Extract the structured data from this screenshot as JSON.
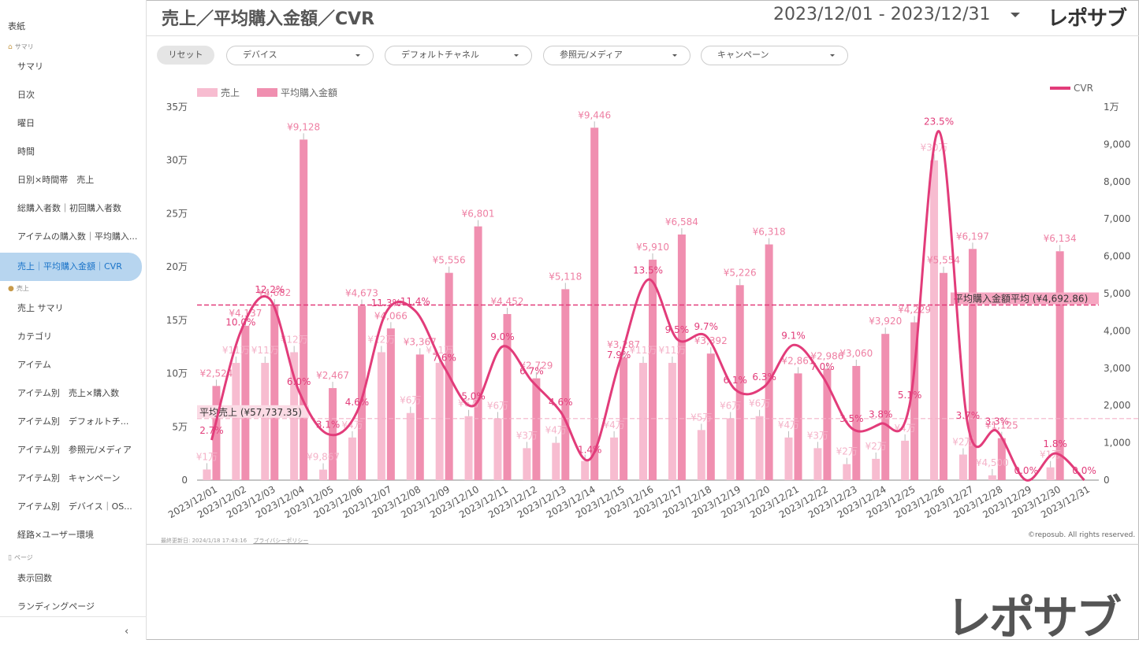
{
  "sidebar": {
    "top_label": "表紙",
    "sections": [
      {
        "label": "サマリ",
        "items": [
          "サマリ",
          "日次",
          "曜日",
          "時間",
          "日別×時間帯　売上",
          "総購入者数｜初回購入者数",
          "アイテムの購入数｜平均購入...",
          "売上｜平均購入金額｜CVR"
        ]
      },
      {
        "label": "売上",
        "items": [
          "売上 サマリ",
          "カテゴリ",
          "アイテム",
          "アイテム別　売上×購入数",
          "アイテム別　デフォルトチ...",
          "アイテム別　参照元/メディア",
          "アイテム別　キャンペーン",
          "アイテム別　デバイス｜OS...",
          "経路×ユーザー環境"
        ]
      },
      {
        "label": "ページ",
        "items": [
          "表示回数",
          "ランディングページ"
        ]
      }
    ],
    "active_item": "売上｜平均購入金額｜CVR",
    "collapse_icon": "chevron-left-icon"
  },
  "header": {
    "title": "売上／平均購入金額／CVR",
    "date_range": "2023/12/01 - 2023/12/31",
    "logo": "レポサブ"
  },
  "filters": {
    "reset_label": "リセット",
    "items": [
      "デバイス",
      "デフォルトチャネル",
      "参照元/メディア",
      "キャンペーン"
    ]
  },
  "footer": {
    "updated": "最終更新日: 2024/1/18 17:43:16",
    "privacy": "プライバシーポリシー",
    "copyright": "©reposub. All rights reserved."
  },
  "logo_bottom": "レポサブ",
  "colors": {
    "sales": "#f7bcd0",
    "avg": "#f08fb0",
    "cvr": "#e23c7a"
  },
  "chart_data": {
    "type": "bar",
    "legend": {
      "left": [
        "売上",
        "平均購入金額"
      ],
      "right": "CVR"
    },
    "left_ticks": [
      "0",
      "5万",
      "10万",
      "15万",
      "20万",
      "25万",
      "30万",
      "35万"
    ],
    "right_ticks": [
      "0",
      "1,000",
      "2,000",
      "3,000",
      "4,000",
      "5,000",
      "6,000",
      "7,000",
      "8,000",
      "9,000",
      "1万"
    ],
    "ylim_left": [
      0,
      350000
    ],
    "ylim_right": [
      0,
      10000
    ],
    "categories": [
      "2023/12/01",
      "2023/12/02",
      "2023/12/03",
      "2023/12/04",
      "2023/12/05",
      "2023/12/06",
      "2023/12/07",
      "2023/12/08",
      "2023/12/09",
      "2023/12/10",
      "2023/12/11",
      "2023/12/12",
      "2023/12/13",
      "2023/12/14",
      "2023/12/15",
      "2023/12/16",
      "2023/12/17",
      "2023/12/18",
      "2023/12/19",
      "2023/12/20",
      "2023/12/21",
      "2023/12/22",
      "2023/12/23",
      "2023/12/24",
      "2023/12/25",
      "2023/12/26",
      "2023/12/27",
      "2023/12/28",
      "2023/12/29",
      "2023/12/30",
      "2023/12/31"
    ],
    "series": [
      {
        "name": "売上",
        "values": [
          10000,
          110000,
          110000,
          120000,
          9867,
          40000,
          120000,
          63000,
          110000,
          60000,
          58000,
          30000,
          35000,
          18000,
          40000,
          110000,
          110000,
          47000,
          58000,
          60000,
          40000,
          30000,
          15000,
          20000,
          37000,
          300000,
          24000,
          4500,
          0,
          12000,
          0
        ],
        "labels": [
          "¥1万",
          "¥11万",
          "¥11万",
          "¥12万",
          "¥9,867",
          "¥4万",
          "¥12万",
          "¥6万",
          "¥11万",
          "¥6万",
          "¥6万",
          "¥3万",
          "¥4万",
          "",
          "¥4万",
          "¥11万",
          "¥11万",
          "¥5万",
          "¥6万",
          "¥6万",
          "¥4万",
          "¥3万",
          "¥2万",
          "¥2万",
          "¥4万",
          "¥30万",
          "¥2万",
          "¥4,500",
          "",
          "¥1万",
          ""
        ]
      },
      {
        "name": "平均購入金額",
        "values": [
          2524,
          4137,
          4682,
          9128,
          2467,
          4673,
          4066,
          3367,
          5556,
          6801,
          4452,
          2729,
          5118,
          9446,
          3287,
          5910,
          6584,
          3392,
          5226,
          6318,
          2861,
          2986,
          3060,
          3920,
          4229,
          5554,
          6197,
          1125,
          0,
          6134,
          0
        ],
        "labels": [
          "¥2,524",
          "¥4,137",
          "¥4,682",
          "¥9,128",
          "¥2,467",
          "¥4,673",
          "¥4,066",
          "¥3,367",
          "¥5,556",
          "¥6,801",
          "¥4,452",
          "¥2,729",
          "¥5,118",
          "¥9,446",
          "¥3,287",
          "¥5,910",
          "¥6,584",
          "¥3,392",
          "¥5,226",
          "¥6,318",
          "¥2,861",
          "¥2,986",
          "¥3,060",
          "¥3,920",
          "¥4,229",
          "¥5,554",
          "¥6,197",
          "¥1,125",
          "",
          "¥6,134",
          ""
        ]
      },
      {
        "name": "CVR",
        "values": [
          2.7,
          10.0,
          12.2,
          6.0,
          3.1,
          4.6,
          11.3,
          11.4,
          7.6,
          5.0,
          9.0,
          6.7,
          4.6,
          1.4,
          7.8,
          13.5,
          9.5,
          9.7,
          6.1,
          6.3,
          9.1,
          7.0,
          3.5,
          3.8,
          5.1,
          23.5,
          3.7,
          3.3,
          0.0,
          1.8,
          0.0
        ],
        "labels": [
          "2.7%",
          "10.0%",
          "12.2%",
          "6.0%",
          "3.1%",
          "4.6%",
          "11.3%",
          "11.4%",
          "7.6%",
          "5.0%",
          "9.0%",
          "6.7%",
          "4.6%",
          "1.4%",
          "7.9%",
          "13.5%",
          "9.5%",
          "9.7%",
          "6.1%",
          "6.3%",
          "9.1%",
          "7.0%",
          "3.5%",
          "3.8%",
          "5.1%",
          "23.5%",
          "3.7%",
          "3.3%",
          "0.0%",
          "1.8%",
          "0.0%"
        ]
      }
    ],
    "reference_lines": [
      {
        "label": "平均購入金額平均 (¥4,692.86)",
        "value": 4692.86,
        "axis": "right"
      },
      {
        "label": "平均売上 (¥57,737.35)",
        "value": 57737.35,
        "axis": "left"
      }
    ],
    "grid": false
  }
}
